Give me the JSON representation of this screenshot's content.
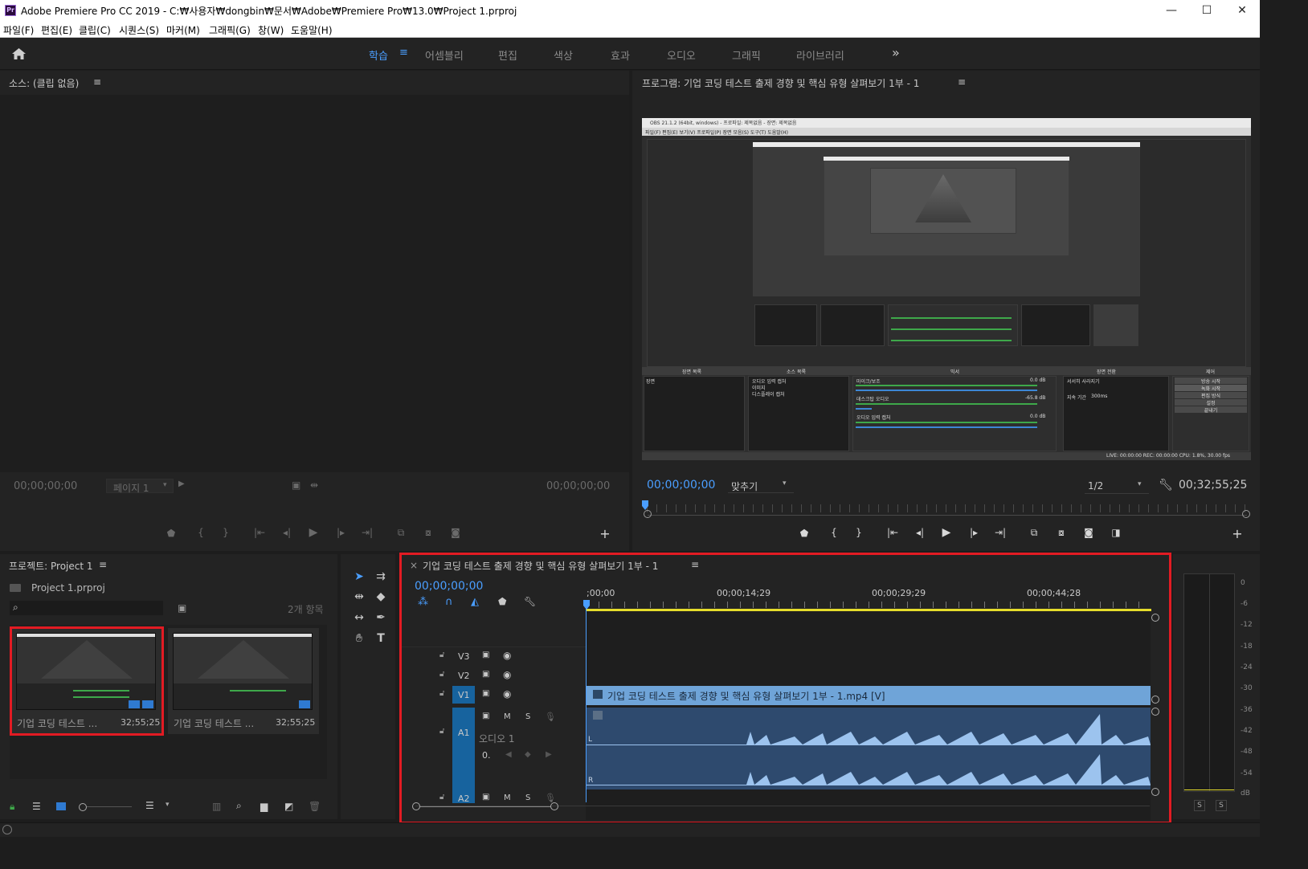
{
  "window": {
    "app_icon_text": "Pr",
    "title": "Adobe Premiere Pro CC 2019 - C:₩사용자₩dongbin₩문서₩Adobe₩Premiere Pro₩13.0₩Project 1.prproj",
    "minimize": "—",
    "maximize": "☐",
    "close": "✕"
  },
  "menu": [
    "파일(F)",
    "편집(E)",
    "클립(C)",
    "시퀀스(S)",
    "마커(M)",
    "그래픽(G)",
    "창(W)",
    "도움말(H)"
  ],
  "workspaces": {
    "items": [
      "학습",
      "어셈블리",
      "편집",
      "색상",
      "효과",
      "오디오",
      "그래픽",
      "라이브러리"
    ],
    "active": "학습",
    "overflow": "»",
    "menu_icon": "≡"
  },
  "source": {
    "title": "소스: (클립 없음)",
    "menu_icon": "≡",
    "timecode_left": "00;00;00;00",
    "page_select": "페이지 1",
    "timecode_right": "00;00;00;00"
  },
  "program": {
    "title": "프로그램: 기업 코딩 테스트 출제 경향 및 핵심 유형 살펴보기 1부 - 1",
    "menu_icon": "≡",
    "timecode": "00;00;00;00",
    "fit": "맞추기",
    "resolution": "1/2",
    "duration": "00;32;55;25",
    "mock": {
      "window_title": "OBS 21.1.2 (64bit, windows) - 프로파일: 제목없음 - 장면: 제목없음",
      "menu": "파일(F)  편집(E)  보기(V)  프로파일(P)  장면 모음(S)  도구(T)  도움말(H)",
      "dock_titles": [
        "장면 목록",
        "소스 목록",
        "믹서",
        "장면 전환",
        "제어"
      ],
      "sources": [
        "오디오 입력 캡처",
        "이미지",
        "디스플레이 캡처"
      ],
      "scene": "장면",
      "mixer": [
        {
          "name": "마이크/보조",
          "db": "0.0 dB"
        },
        {
          "name": "데스크탑 오디오",
          "db": "-65.8 dB"
        },
        {
          "name": "오디오 입력 캡처",
          "db": "0.0 dB"
        }
      ],
      "transition": "서서히 사라지기",
      "duration_label": "지속 기간",
      "duration_value": "300ms",
      "controls": [
        "방송 시작",
        "녹화 시작",
        "편집 방식",
        "설정",
        "끝내기"
      ],
      "status": "LIVE: 00:00:00   REC: 00:00:00   CPU: 1.8%, 30.00 fps"
    }
  },
  "project": {
    "title": "프로젝트: Project 1",
    "menu_icon": "≡",
    "file": "Project 1.prproj",
    "search_placeholder": "",
    "count": "2개 항목",
    "items": [
      {
        "name": "기업 코딩 테스트 ...",
        "duration": "32;55;25"
      },
      {
        "name": "기업 코딩 테스트 ...",
        "duration": "32;55;25"
      }
    ]
  },
  "timeline": {
    "close": "×",
    "title": "기업 코딩 테스트 출제 경향 및 핵심 유형 살펴보기 1부 - 1",
    "menu_icon": "≡",
    "timecode": "00;00;00;00",
    "ruler": [
      ";00;00",
      "00;00;14;29",
      "00;00;29;29",
      "00;00;44;28"
    ],
    "tracks": {
      "v3": "V3",
      "v2": "V2",
      "v1": "V1",
      "a1": "A1",
      "a2": "A2",
      "audio_name": "오디오 1",
      "m": "M",
      "s": "S",
      "volume": "0."
    },
    "clip_label": "기업 코딩 테스트 출제 경향 및 핵심 유형 살펴보기 1부 - 1.mp4 [V]",
    "channel_l": "L",
    "channel_r": "R"
  },
  "meter": {
    "scale": [
      "0",
      "-6",
      "-12",
      "-18",
      "-24",
      "-30",
      "-36",
      "-42",
      "-48",
      "-54",
      "dB"
    ],
    "solo_left": "S",
    "solo_right": "S"
  },
  "colors": {
    "accent": "#4a9eff",
    "highlight_border": "#e21b23",
    "clip_video": "#6fa4d8",
    "clip_audio": "#2e4a6e",
    "waveform": "#9cc3ee",
    "work_area": "#e5dc2c"
  }
}
